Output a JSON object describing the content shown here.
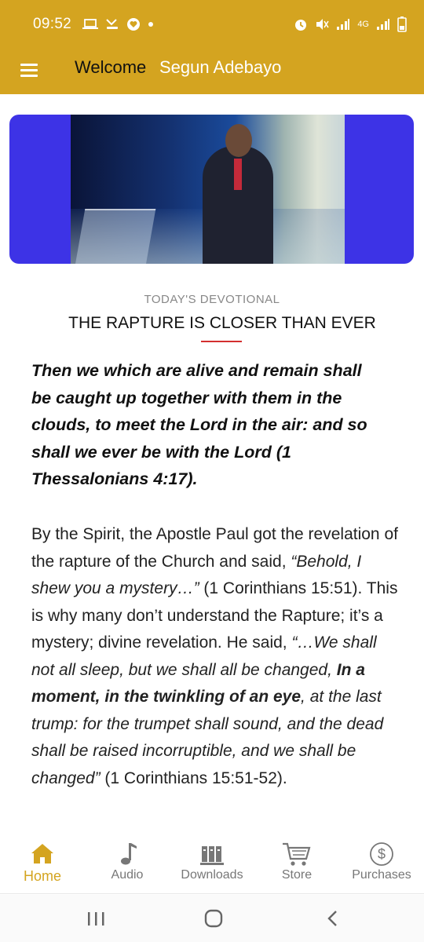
{
  "status_bar": {
    "time": "09:52",
    "left_icons": [
      "laptop-icon",
      "missed-call-icon",
      "heart-badge-icon",
      "dot-icon"
    ],
    "right_icons": [
      "alarm-icon",
      "mute-icon",
      "signal-icon",
      "4g-icon",
      "signal-icon",
      "battery-icon"
    ],
    "network": "4G"
  },
  "app_bar": {
    "welcome": "Welcome",
    "user_name": "Segun Adebayo",
    "color": "#d4a420"
  },
  "devotional": {
    "section_label": "TODAY'S DEVOTIONAL",
    "title": "THE RAPTURE IS CLOSER THAN EVER",
    "scripture": "Then we which are alive and remain shall be caught up together with them in the clouds, to meet the Lord in the air: and so shall we ever be with the Lord (1 Thessalonians 4:17).",
    "body": {
      "p1": "By the Spirit, the Apostle Paul got the revelation of the rapture of the Church and said, ",
      "q1": "“Behold, I shew you a mystery…”",
      "p2": " (1 Corinthians 15:51). This is why many don’t understand the Rapture; it’s a mystery; divine revelation. He said, ",
      "q2": "“…We shall not all sleep, but we shall all be changed, ",
      "q2_bold": "In a moment, in the twinkling of an eye",
      "q3": ", at the last trump: for the trumpet shall sound, and the dead shall be raised incorruptible, and we shall be changed”",
      "p3": " (1 Corinthians 15:51-52)."
    }
  },
  "bottom_nav": {
    "items": [
      {
        "label": "Home",
        "icon": "home-icon",
        "active": true
      },
      {
        "label": "Audio",
        "icon": "music-note-icon",
        "active": false
      },
      {
        "label": "Downloads",
        "icon": "library-icon",
        "active": false
      },
      {
        "label": "Store",
        "icon": "cart-icon",
        "active": false
      },
      {
        "label": "Purchases",
        "icon": "dollar-circle-icon",
        "active": false
      }
    ],
    "accent": "#d4a420"
  },
  "system_nav": [
    "recents-button",
    "home-button",
    "back-button"
  ]
}
